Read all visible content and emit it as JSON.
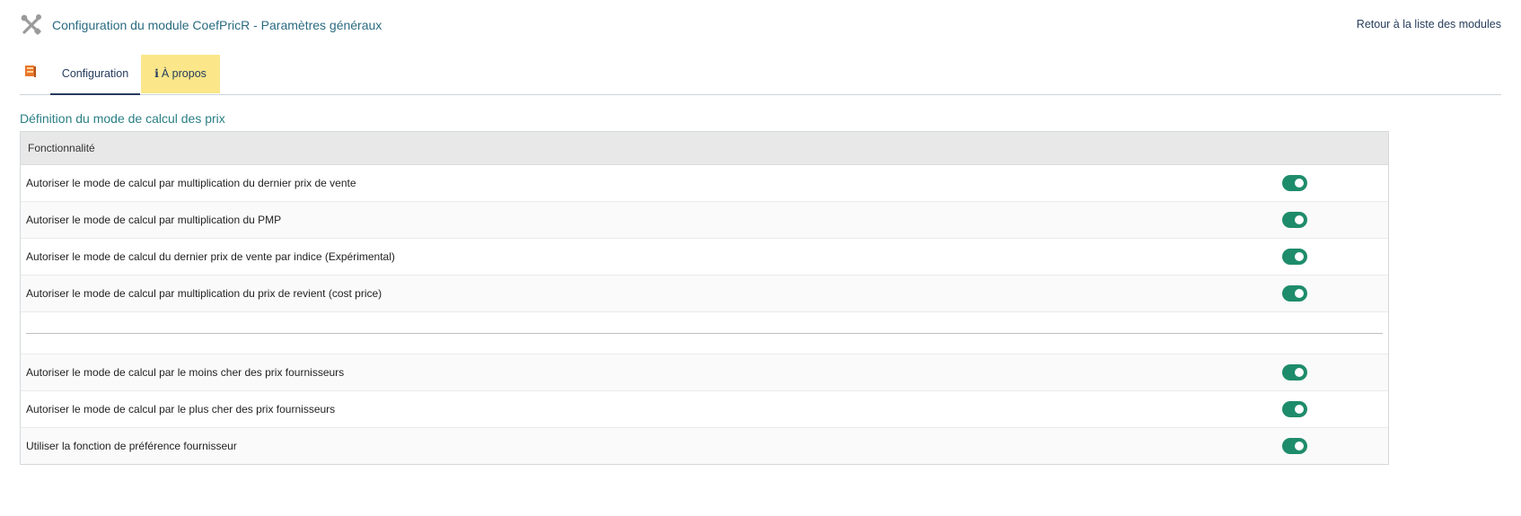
{
  "header": {
    "title": "Configuration du module CoefPricR - Paramètres généraux",
    "icon": "tools-icon",
    "back_link": "Retour à la liste des modules"
  },
  "tabs": {
    "logo_icon": "module-logo-icon",
    "items": [
      {
        "label": "Configuration",
        "active": true
      },
      {
        "label": "À propos",
        "icon": "info-icon",
        "highlight_color": "#fbe78a"
      }
    ]
  },
  "section": {
    "title": "Définition du mode de calcul des prix",
    "column_header": "Fonctionnalité"
  },
  "rows": [
    {
      "label": "Autoriser le mode de calcul par multiplication du dernier prix de vente",
      "enabled": true
    },
    {
      "label": "Autoriser le mode de calcul par multiplication du PMP",
      "enabled": true
    },
    {
      "label": "Autoriser le mode de calcul du dernier prix de vente par indice (Expérimental)",
      "enabled": true
    },
    {
      "label": "Autoriser le mode de calcul par multiplication du prix de revient (cost price)",
      "enabled": true
    },
    {
      "label": "Autoriser le mode de calcul par le moins cher des prix fournisseurs",
      "enabled": true
    },
    {
      "label": "Autoriser le mode de calcul par le plus cher des prix fournisseurs",
      "enabled": true
    },
    {
      "label": "Utiliser la fonction de préférence fournisseur",
      "enabled": true
    }
  ],
  "colors": {
    "toggle_on": "#1e8c6a",
    "title_teal": "#2a6b80",
    "nav_dark": "#263c5c"
  }
}
